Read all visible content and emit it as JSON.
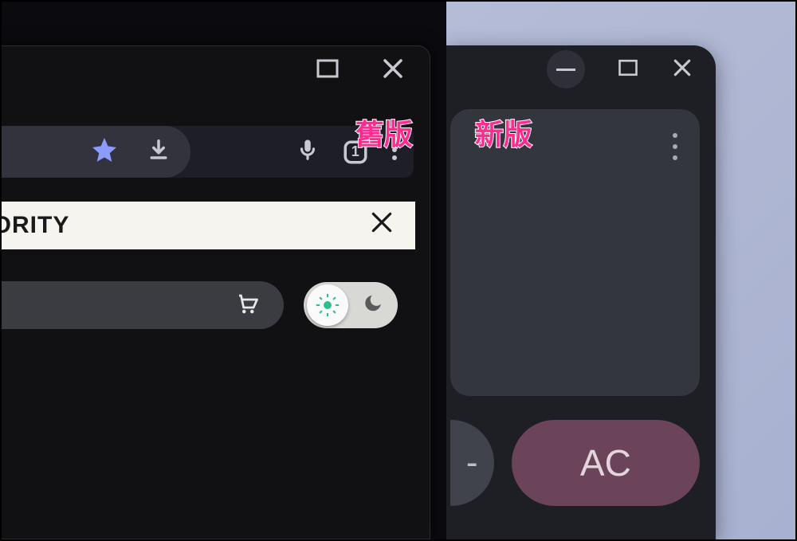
{
  "labels": {
    "old_version": "舊版",
    "new_version": "新版"
  },
  "old_window": {
    "banner_text": "HORITY",
    "tab_count": "1"
  },
  "new_window": {
    "calc": {
      "dash": "-",
      "ac": "AC"
    }
  }
}
